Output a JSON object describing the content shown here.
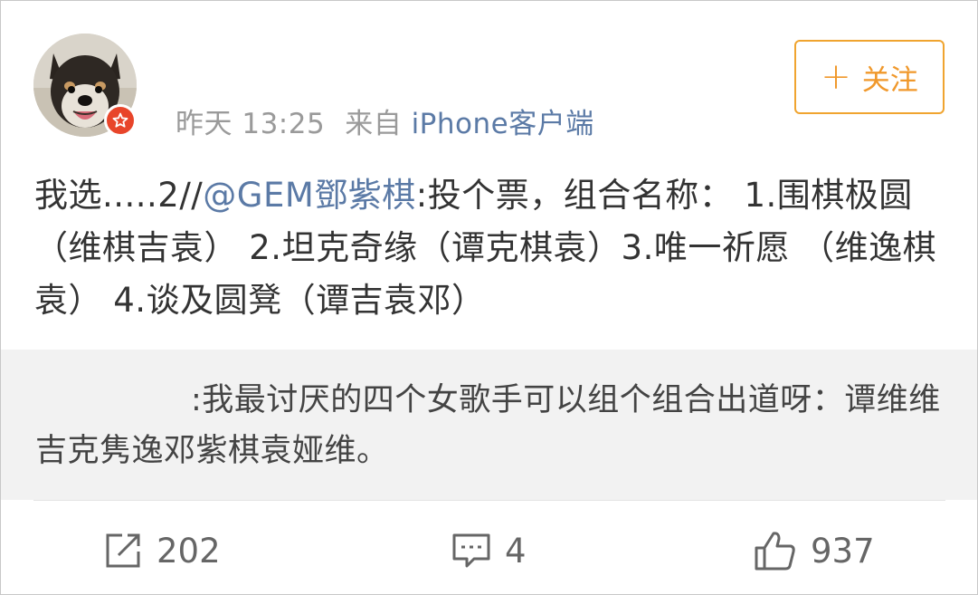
{
  "post": {
    "meta": {
      "time": "昨天 13:25",
      "source_prefix": "来自",
      "source": "iPhone客户端"
    },
    "follow_label": "关注",
    "text_prefix": "我选.....2//",
    "mention": "@GEM鄧紫棋",
    "text_body": ":投个票，组合名称： 1.围棋极圆（维棋吉袁） 2.坦克奇缘（谭克棋袁）3.唯一祈愿 （维逸棋袁） 4.谈及圆凳（谭吉袁邓）",
    "quote_text": ":我最讨厌的四个女歌手可以组个组合出道呀：谭维维吉克隽逸邓紫棋袁娅维。"
  },
  "actions": {
    "repost_count": "202",
    "comment_count": "4",
    "like_count": "937"
  },
  "icons": {
    "verified": "verified-badge-icon",
    "plus": "plus-icon",
    "repost": "repost-icon",
    "comment": "comment-icon",
    "like": "thumbs-up-icon"
  },
  "colors": {
    "accent_orange": "#f0982b",
    "link_blue": "#5b7aa6",
    "verified_red": "#e8452a",
    "quote_bg": "#f2f2f2"
  }
}
